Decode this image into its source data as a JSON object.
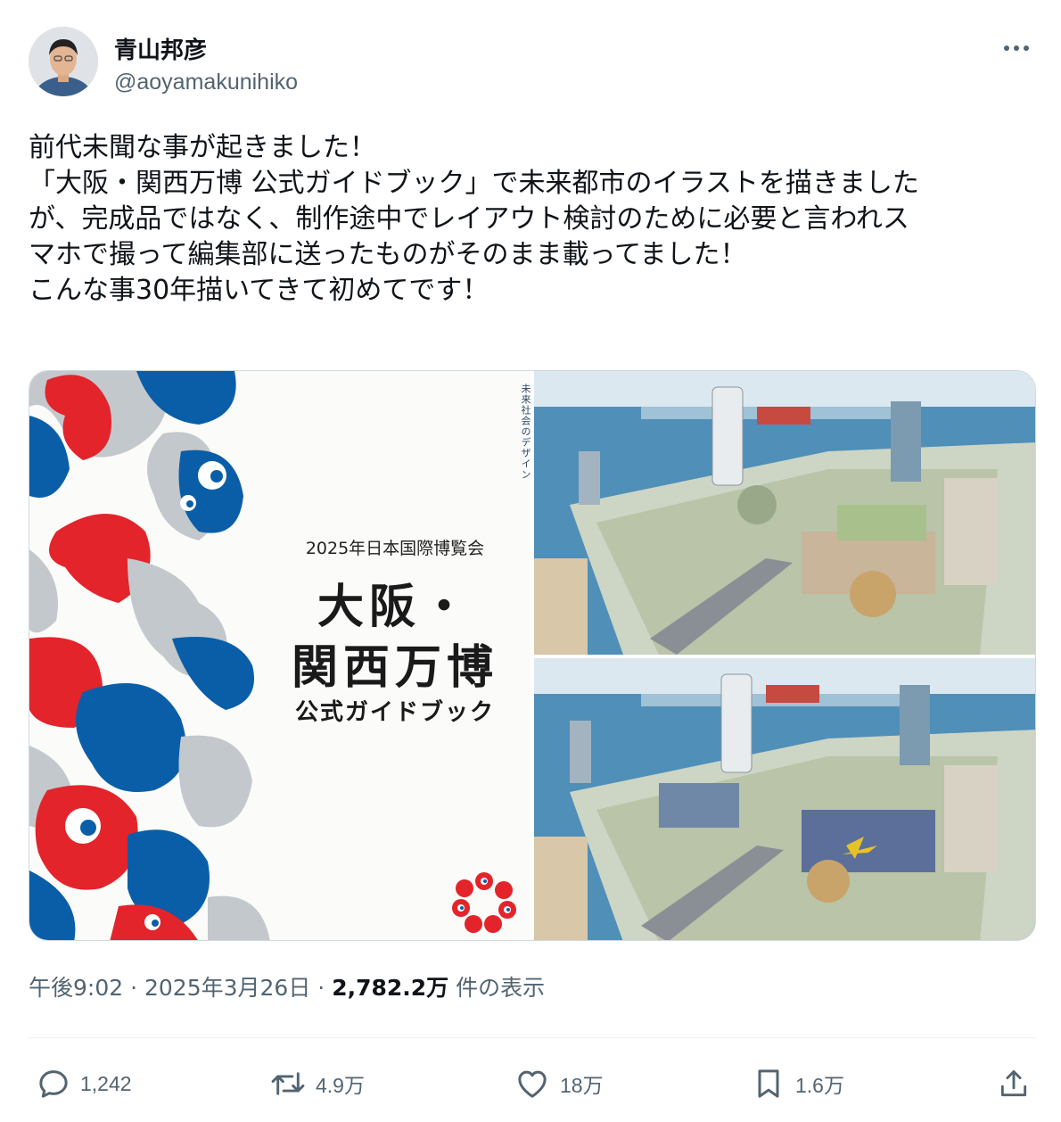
{
  "author": {
    "display_name": "青山邦彦",
    "handle": "@aoyamakunihiko"
  },
  "tweet": {
    "lines": [
      "前代未聞な事が起きました！",
      "「大阪・関西万博 公式ガイドブック」で未来都市のイラストを描きました",
      "が、完成品ではなく、制作途中でレイアウト検討のために必要と言われス",
      "マホで撮って編集部に送ったものがそのまま載ってました！",
      "こんな事30年描いてきて初めてです！"
    ]
  },
  "media": {
    "cover": {
      "vertical_text": "未来社会のデザイン",
      "expo_line": "2025年日本国際博覧会",
      "title_line1": "大阪・",
      "title_line2": "関西万博",
      "subtitle": "公式ガイドブック"
    },
    "colors": {
      "red": "#e3242b",
      "blue": "#0a5ea8",
      "gray": "#c3c8cd",
      "sea": "#4f8fb8",
      "sky": "#dbe8ef"
    }
  },
  "meta": {
    "time": "午後9:02",
    "separator": "·",
    "date": "2025年3月26日",
    "views_count": "2,782.2万",
    "views_label": "件の表示"
  },
  "actions": {
    "reply_count": "1,242",
    "repost_count": "4.9万",
    "like_count": "18万",
    "bookmark_count": "1.6万"
  },
  "icons": [
    "more-icon",
    "reply-icon",
    "repost-icon",
    "like-icon",
    "bookmark-icon",
    "share-icon"
  ]
}
